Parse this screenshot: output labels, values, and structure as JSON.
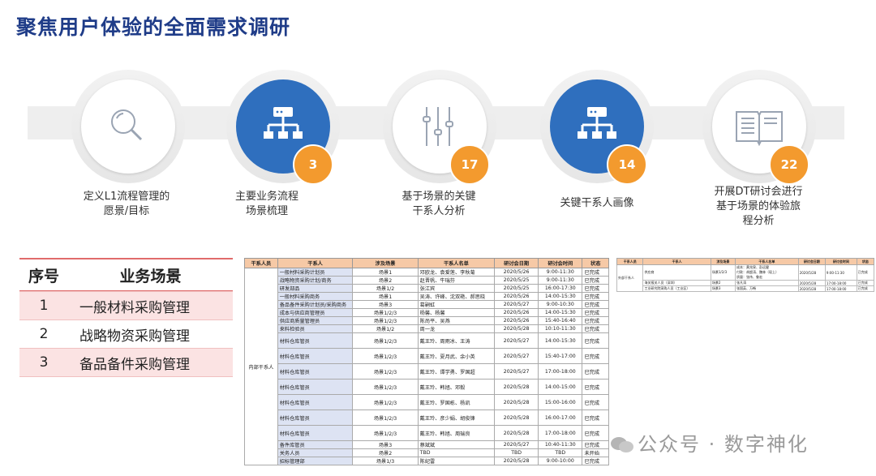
{
  "title": "聚焦用户体验的全面需求调研",
  "steps": [
    {
      "caption": "定义L1流程管理的\n愿景/目标",
      "badge": "",
      "icon": "magnifier-icon"
    },
    {
      "caption": "主要业务流程\n场景梳理",
      "badge": "3",
      "icon": "network-icon"
    },
    {
      "caption": "基于场景的关键\n干系人分析",
      "badge": "17",
      "icon": "sliders-icon"
    },
    {
      "caption": "关键干系人画像",
      "badge": "14",
      "icon": "network-icon"
    },
    {
      "caption": "开展DT研讨会进行\n基于场景的体验旅\n程分析",
      "badge": "22",
      "icon": "book-icon"
    }
  ],
  "scenarios": {
    "headers": [
      "序号",
      "业务场景"
    ],
    "rows": [
      {
        "no": "1",
        "name": "一般材料采购管理"
      },
      {
        "no": "2",
        "name": "战略物资采购管理"
      },
      {
        "no": "3",
        "name": "备品备件采购管理"
      }
    ]
  },
  "schedule": {
    "headers": [
      "干系人员",
      "干系人",
      "涉及场景",
      "干系人名单",
      "研讨会日期",
      "研讨会时间",
      "状态"
    ],
    "group": "内部干系人",
    "rows": [
      [
        "一般材料采购计划员",
        "场景1",
        "邓欧龙、袁爱莲、李秋菊",
        "2020/5/26",
        "9:00-11:30",
        "已完成"
      ],
      [
        "战略物资采购计划/商务",
        "场景2",
        "赵晋帆、牛瑞芬",
        "2020/5/25",
        "9:00-11:30",
        "已完成"
      ],
      [
        "研发部品",
        "场景1/2",
        "张江宾",
        "2020/5/25",
        "16:00-17:30",
        "已完成"
      ],
      [
        "一般材料采购商务",
        "场景1",
        "吴涛、许峰、沈双艳、郝思晓",
        "2020/5/26",
        "14:00-15:30",
        "已完成"
      ],
      [
        "备品备件采购计划员/采购商务",
        "场景3",
        "葛嗣虹",
        "2020/5/27",
        "9:00-10:30",
        "已完成"
      ],
      [
        "成本与供应商管理员",
        "场景1/2/3",
        "杨馨、杨馨",
        "2020/5/26",
        "14:00-15:30",
        "已完成"
      ],
      [
        "供应商质量管理员",
        "场景1/2/3",
        "陈尚平、吴燕",
        "2020/5/26",
        "15:40-16:40",
        "已完成"
      ],
      [
        "来料检验员",
        "场景1/2",
        "周一龙",
        "2020/5/28",
        "10:10-11:30",
        "已完成"
      ],
      [
        "材料仓库管员",
        "场景1/2/3",
        "戴王玲、周雨冰、王涛",
        "2020/5/27",
        "14:00-15:30",
        "已完成"
      ],
      [
        "材料仓库管员",
        "场景1/2/3",
        "戴王玲、夏月武、余小英",
        "2020/5/27",
        "15:40-17:00",
        "已完成"
      ],
      [
        "材料仓库管员",
        "场景1/2/3",
        "戴王玲、谭学勇、罗国超",
        "2020/5/27",
        "17:00-18:00",
        "已完成"
      ],
      [
        "材料仓库管员",
        "场景1/2/3",
        "戴王玲、韩旭、邓毅",
        "2020/5/28",
        "14:00-15:00",
        "已完成"
      ],
      [
        "材料仓库管员",
        "场景1/2/3",
        "戴王玲、罗国栋、杨凯",
        "2020/5/28",
        "15:00-16:00",
        "已完成"
      ],
      [
        "材料仓库管员",
        "场景1/2/3",
        "戴王玲、彦少娟、胡俊锋",
        "2020/5/28",
        "16:00-17:00",
        "已完成"
      ],
      [
        "材料仓库管员",
        "场景1/2/3",
        "戴王玲、韩旭、周瑞良",
        "2020/5/28",
        "17:00-18:00",
        "已完成"
      ],
      [
        "备件库管员",
        "场景3",
        "蔡斌斌",
        "2020/5/27",
        "10:40-11:30",
        "已完成"
      ],
      [
        "关务人员",
        "场景2",
        "TBD",
        "TBD",
        "TBD",
        "未开始"
      ],
      [
        "招标管理部",
        "场景1/3",
        "陈纪雷",
        "2020/5/28",
        "9:00-10:00",
        "已完成"
      ]
    ]
  },
  "mini_schedule": {
    "headers": [
      "干系人员",
      "干系人",
      "涉及场景",
      "干系人名单",
      "研讨会日期",
      "研讨会时间",
      "状态"
    ],
    "group": "外部干系人",
    "rows": [
      [
        "供应商",
        "场景1/2/3",
        "成本：黄兆泉、彭远健\n付款：胡超涛、魏林（现上）\n质量：张伟、鲁宏",
        "2020/5/28",
        "9:00-11:30",
        "已完成"
      ],
      [
        "海关报关人员（深圳）",
        "场景2",
        "张凡涛",
        "2020/5/28",
        "17:00-18:00",
        "已完成"
      ],
      [
        "工业研究院采购人员（工业区）",
        "场景3",
        "张国英、万畅",
        "2020/5/28",
        "17:00-18:00",
        "已完成"
      ]
    ]
  },
  "watermark": "公众号 · 数字神化"
}
